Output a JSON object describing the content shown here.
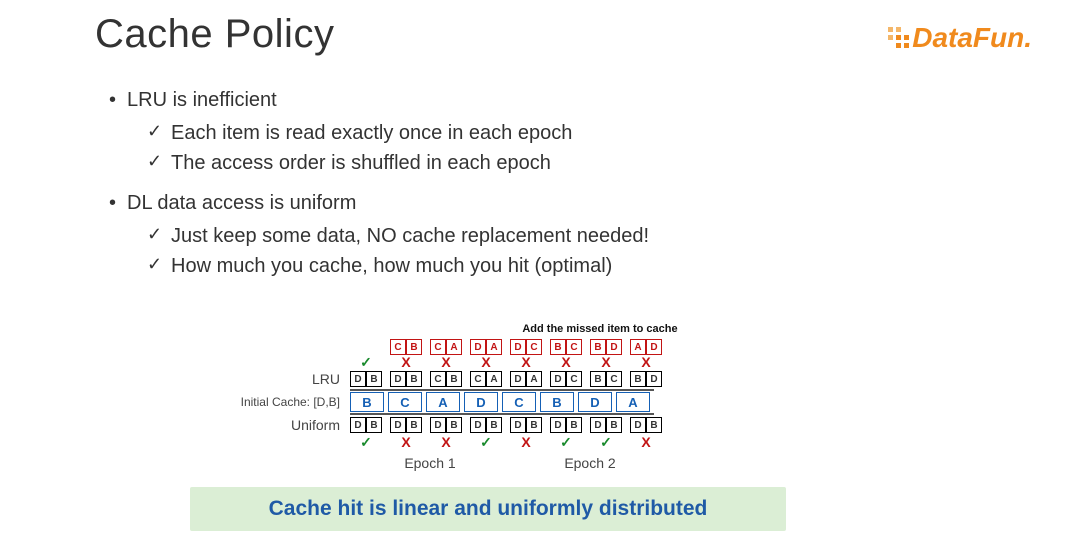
{
  "title": "Cache Policy",
  "logo": {
    "text": "DataFun."
  },
  "bullets": [
    {
      "text": "LRU is inefficient",
      "subs": [
        "Each item is read exactly once in each epoch",
        "The access order is shuffled in each epoch"
      ]
    },
    {
      "text": "DL data access is uniform",
      "subs": [
        "Just keep some data, NO cache replacement needed!",
        "How much you cache, how much you hit (optimal)"
      ]
    }
  ],
  "diagram": {
    "caption": "Add the missed  item to cache",
    "row_lru_label": "LRU",
    "initial_label": "Initial Cache: [D,B]",
    "row_uniform_label": "Uniform",
    "epoch1": "Epoch 1",
    "epoch2": "Epoch 2",
    "miss_boxes": [
      [
        "C",
        "B"
      ],
      [
        "C",
        "A"
      ],
      [
        "D",
        "A"
      ],
      [
        "D",
        "C"
      ],
      [
        "B",
        "C"
      ],
      [
        "B",
        "D"
      ],
      [
        "A",
        "D"
      ]
    ],
    "lru_marks": [
      "✓",
      "X",
      "X",
      "X",
      "X",
      "X",
      "X",
      "X"
    ],
    "lru_cache": [
      [
        "D",
        "B"
      ],
      [
        "D",
        "B"
      ],
      [
        "C",
        "B"
      ],
      [
        "C",
        "A"
      ],
      [
        "D",
        "A"
      ],
      [
        "D",
        "C"
      ],
      [
        "B",
        "C"
      ],
      [
        "B",
        "D"
      ]
    ],
    "sequence": [
      "B",
      "C",
      "A",
      "D",
      "C",
      "B",
      "D",
      "A"
    ],
    "uniform_cache": [
      [
        "D",
        "B"
      ],
      [
        "D",
        "B"
      ],
      [
        "D",
        "B"
      ],
      [
        "D",
        "B"
      ],
      [
        "D",
        "B"
      ],
      [
        "D",
        "B"
      ],
      [
        "D",
        "B"
      ],
      [
        "D",
        "B"
      ]
    ],
    "uniform_marks": [
      "✓",
      "X",
      "X",
      "✓",
      "X",
      "✓",
      "✓",
      "X"
    ]
  },
  "banner": "Cache hit is linear and uniformly distributed"
}
